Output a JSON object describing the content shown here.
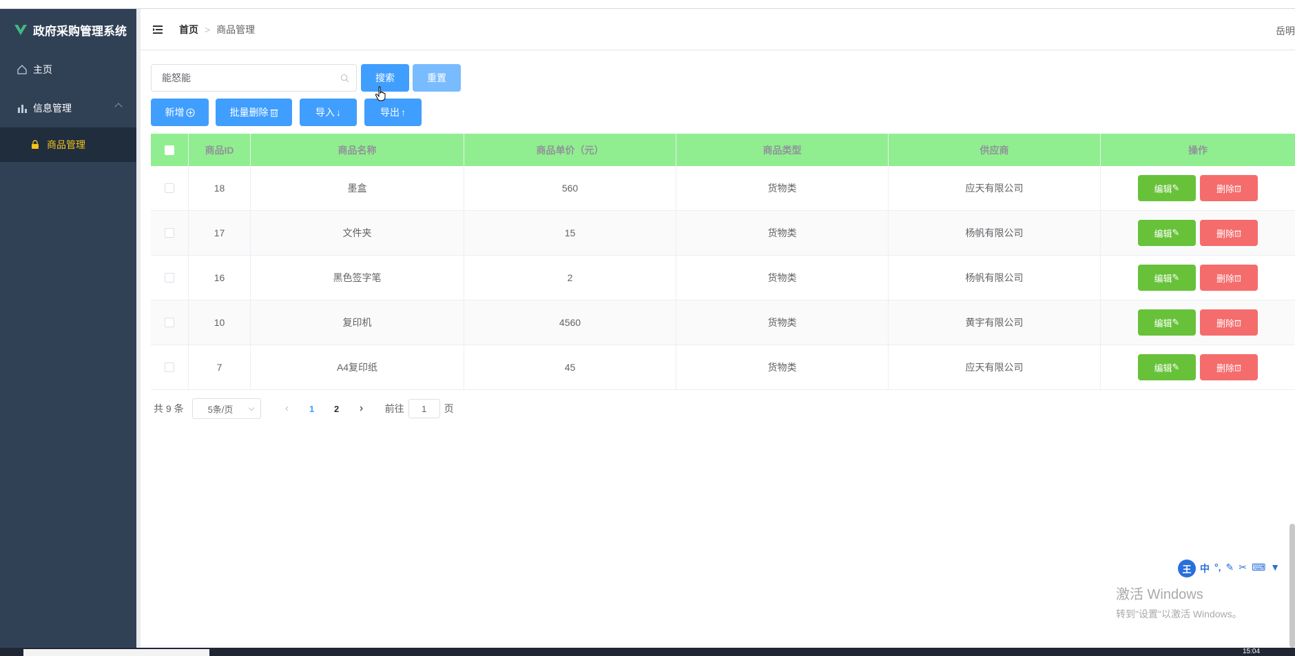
{
  "app": {
    "title": "政府采购管理系统"
  },
  "sidebar": {
    "items": [
      {
        "label": "主页",
        "icon": "home-icon"
      },
      {
        "label": "信息管理",
        "icon": "bar-chart-icon",
        "expanded": true,
        "children": [
          {
            "label": "商品管理",
            "icon": "lock-icon",
            "active": true
          }
        ]
      }
    ]
  },
  "header": {
    "breadcrumb": {
      "home": "首页",
      "current": "商品管理"
    },
    "user": "岳明"
  },
  "toolbar": {
    "search_value": "能怒能",
    "search_label": "搜索",
    "reset_label": "重置",
    "add_label": "新增",
    "batch_delete_label": "批量删除",
    "import_label": "导入",
    "export_label": "导出"
  },
  "table": {
    "headers": [
      "商品ID",
      "商品名称",
      "商品单价（元）",
      "商品类型",
      "供应商",
      "操作"
    ],
    "header_color": "#90ee90",
    "edit_label": "编辑",
    "delete_label": "删除",
    "rows": [
      {
        "id": "18",
        "name": "墨盒",
        "price": "560",
        "type": "货物类",
        "supplier": "应天有限公司"
      },
      {
        "id": "17",
        "name": "文件夹",
        "price": "15",
        "type": "货物类",
        "supplier": "杨帆有限公司"
      },
      {
        "id": "16",
        "name": "黑色签字笔",
        "price": "2",
        "type": "货物类",
        "supplier": "杨帆有限公司"
      },
      {
        "id": "10",
        "name": "复印机",
        "price": "4560",
        "type": "货物类",
        "supplier": "黄宇有限公司"
      },
      {
        "id": "7",
        "name": "A4复印纸",
        "price": "45",
        "type": "货物类",
        "supplier": "应天有限公司"
      }
    ]
  },
  "pagination": {
    "total": "共 9 条",
    "page_size": "5条/页",
    "pages": [
      "1",
      "2"
    ],
    "current_page": "1",
    "goto_prefix": "前往",
    "goto_value": "1",
    "goto_suffix": "页"
  },
  "ime": {
    "logo": "王",
    "mode": "中",
    "punct": "°,"
  },
  "watermark": {
    "line1": "激活 Windows",
    "line2": "转到\"设置\"以激活 Windows。"
  },
  "taskbar": {
    "clock": "15:04"
  },
  "colors": {
    "primary": "#409eff",
    "success": "#67c23a",
    "danger": "#f56c6c",
    "sidebar": "#304156",
    "active_menu": "#f4c21b"
  }
}
